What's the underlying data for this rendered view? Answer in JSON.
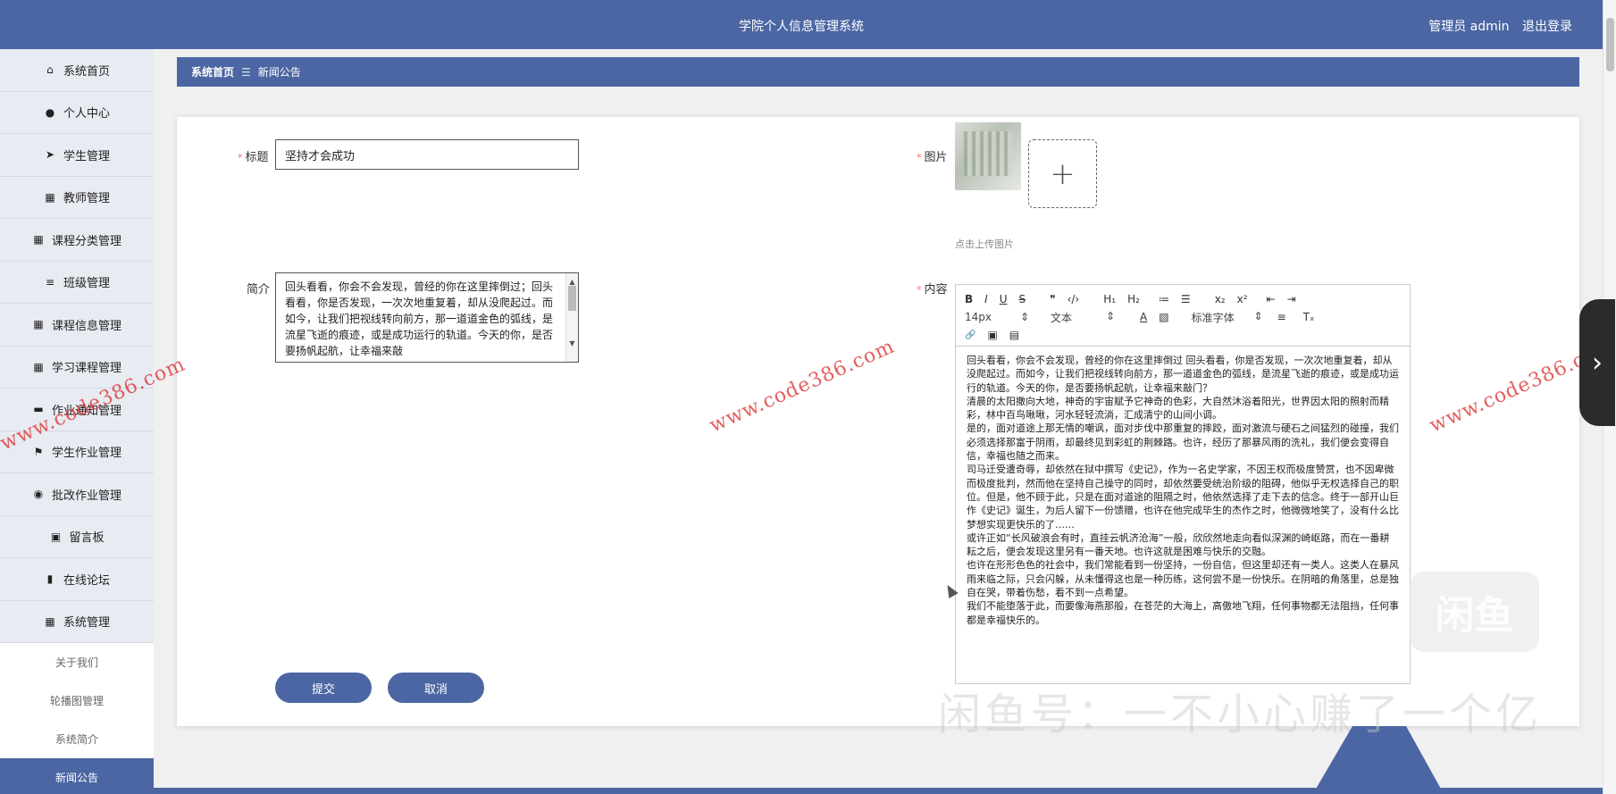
{
  "header": {
    "title": "学院个人信息管理系统",
    "user_label": "管理员 admin",
    "logout": "退出登录"
  },
  "sidebar": {
    "items": [
      {
        "icon": "home-icon",
        "glyph": "⌂",
        "label": "系统首页"
      },
      {
        "icon": "user-icon",
        "glyph": "●",
        "label": "个人中心"
      },
      {
        "icon": "send-icon",
        "glyph": "➤",
        "label": "学生管理"
      },
      {
        "icon": "grid-icon",
        "glyph": "▦",
        "label": "教师管理"
      },
      {
        "icon": "grid-icon",
        "glyph": "▦",
        "label": "课程分类管理"
      },
      {
        "icon": "list-icon",
        "glyph": "≡",
        "label": "班级管理"
      },
      {
        "icon": "grid-icon",
        "glyph": "▦",
        "label": "课程信息管理"
      },
      {
        "icon": "grid-icon",
        "glyph": "▦",
        "label": "学习课程管理"
      },
      {
        "icon": "bookmark-icon",
        "glyph": "▬",
        "label": "作业通知管理"
      },
      {
        "icon": "flag-icon",
        "glyph": "⚑",
        "label": "学生作业管理"
      },
      {
        "icon": "location-icon",
        "glyph": "◉",
        "label": "批改作业管理"
      },
      {
        "icon": "clipboard-icon",
        "glyph": "▣",
        "label": "留言板"
      },
      {
        "icon": "book-icon",
        "glyph": "▮",
        "label": "在线论坛"
      },
      {
        "icon": "grid-icon",
        "glyph": "▦",
        "label": "系统管理"
      }
    ],
    "sub_items": [
      "关于我们",
      "轮播图管理",
      "系统简介",
      "新闻公告"
    ]
  },
  "breadcrumb": {
    "home": "系统首页",
    "sep": "☰",
    "current": "新闻公告"
  },
  "form": {
    "title_label": "标题",
    "title_value": "坚持才会成功",
    "summary_label": "简介",
    "summary_value": "回头看看，你会不会发现，曾经的你在这里摔倒过；回头看看，你是否发现，一次次地重复着，却从没爬起过。而如今，让我们把视线转向前方，那一道道金色的弧线，是流星飞逝的痕迹，或是成功运行的轨道。今天的你，是否要扬帆起航，让幸福来敲",
    "image_label": "图片",
    "upload_plus": "+",
    "upload_hint": "点击上传图片",
    "content_label": "内容",
    "submit": "提交",
    "cancel": "取消"
  },
  "editor": {
    "toolbar_row1": [
      "B",
      "I",
      "U",
      "S",
      "❞",
      "‹/›",
      "H₁",
      "H₂",
      "≔",
      "☰",
      "x₂",
      "x²",
      "⇤",
      "⇥"
    ],
    "font_size": "14px",
    "block_type": "文本",
    "font_family": "标准字体",
    "toolbar_row2_icons": [
      "A",
      "▧",
      "≡",
      "Tₓ"
    ],
    "toolbar_row3": [
      "🔗",
      "▣",
      "▤"
    ],
    "paragraphs": [
      "回头看看，你会不会发现，曾经的你在这里摔倒过 回头看看，你是否发现，一次次地重复着，却从没爬起过。而如今，让我们把视线转向前方，那一道道金色的弧线，是流星飞逝的痕迹，或是成功运行的轨道。今天的你，是否要扬帆起航，让幸福来敲门？",
      "清晨的太阳撒向大地，神奇的宇宙赋予它神奇的色彩，大自然沐浴着阳光，世界因太阳的照射而精彩，林中百鸟啾啾，河水轻轻流淌，汇成清宁的山间小调。",
      "是的，面对道途上那无情的嘲讽，面对步伐中那重复的摔跤，面对激流与硬石之间猛烈的碰撞，我们必须选择那富于阴雨，却最终见到彩虹的荆棘路。也许，经历了那暴风雨的洗礼，我们便会变得自信，幸福也随之而来。",
      "司马迁受遭奇辱，却依然在狱中撰写《史记》，作为一名史学家，不因王权而极度赞赏，也不因卑微而极度批判，然而他在坚持自己操守的同时，却依然要受统治阶级的阻碍，他似乎无权选择自己的职位。但是，他不顾于此，只是在面对道途的阻隔之时，他依然选择了走下去的信念。终于一部开山巨作《史记》诞生，为后人留下一份馈赠，也许在他完成毕生的杰作之时，他微微地笑了，没有什么比梦想实现更快乐的了……",
      "或许正如“长风破浪会有时，直挂云帆济沧海”一般，欣欣然地走向看似深渊的崎岖路，而在一番耕耘之后，便会发现这里另有一番天地。也许这就是困难与快乐的交融。",
      "也许在形形色色的社会中，我们常能看到一份坚持，一份自信，但这里却还有一类人。这类人在暴风雨来临之际，只会闪躲，从未懂得这也是一种历练，这何尝不是一份快乐。在阴暗的角落里，总是独自在哭，带着伤愁，看不到一点希望。",
      "我们不能堕落于此，而要像海燕那般，在苍茫的大海上，高傲地飞翔，任何事物都无法阻挡，任何事都是幸福快乐的。"
    ]
  },
  "overlays": {
    "watermark": "www.code386.com",
    "xianyu_text": "闲鱼号：一不小心赚了一个亿",
    "xianyu_logo": "闲鱼",
    "next": "›"
  },
  "colors": {
    "primary": "#4b66a3",
    "required": "#f56c6c",
    "watermark": "#dc2828"
  }
}
